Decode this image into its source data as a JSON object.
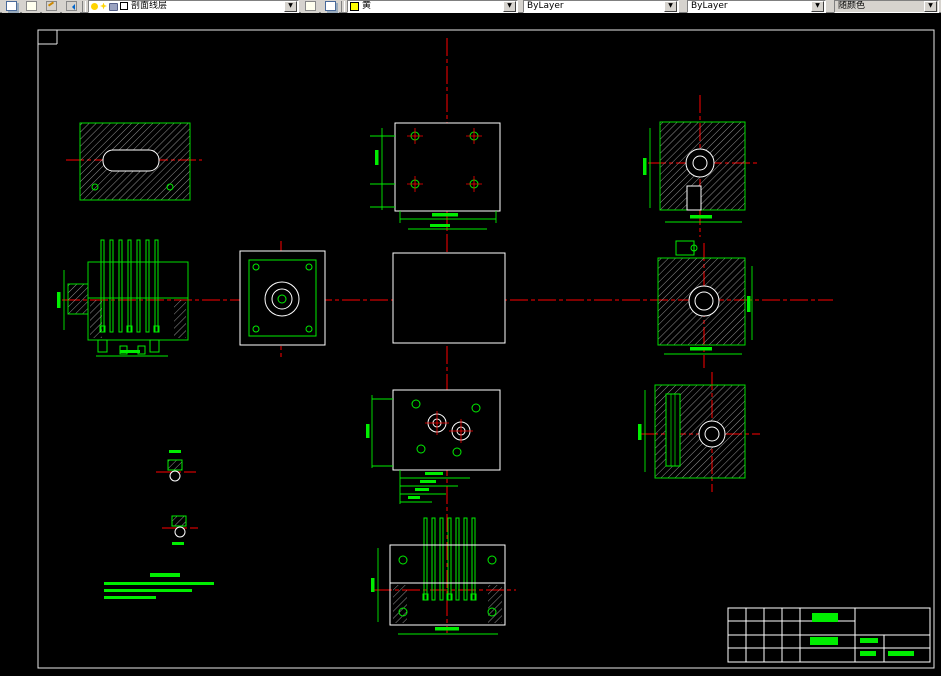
{
  "app": {
    "kind": "cad-drawing-editor",
    "toolbar_bg": "#d6d3ce",
    "canvas_bg": "#000000"
  },
  "toolbar": {
    "icons": {
      "layer_properties": "stacked-sheets",
      "layer_manager": "sheet",
      "make_object_layer_current": "pencil-sheet",
      "layer_previous": "back-arrow",
      "layer_states": "sheet"
    },
    "layer_combo": {
      "value": "剖面线层",
      "state_icons": [
        "layer-on-bulb",
        "layer-thaw-sun",
        "layer-unlock-lock",
        "layer-color-chip"
      ]
    },
    "color_combo": {
      "value": "黄",
      "swatch_hex": "#ffff00"
    },
    "linetype_combo": {
      "value": "ByLayer"
    },
    "lineweight_combo": {
      "value": "ByLayer"
    },
    "plotstyle_combo": {
      "value": "随颜色"
    },
    "dropdown_glyph": "▼"
  },
  "drawing": {
    "line_colors": {
      "outline_white": "#ffffff",
      "entity_green": "#00ee00",
      "centerline_red": "#ff0000",
      "hatch_gray": "#b8b8b8"
    },
    "views_present": [
      "top-clamp-plate-section",
      "top-plate-with-holes",
      "top-right-section",
      "ejector-assembly-side",
      "center-plate-with-bore",
      "cavity-plate-plan",
      "right-section-with-bore",
      "bottom-plate-with-holes",
      "bottom-right-section",
      "bottom-ejector-assembly",
      "detail-a",
      "detail-b",
      "notes-text-block",
      "title-block"
    ]
  }
}
